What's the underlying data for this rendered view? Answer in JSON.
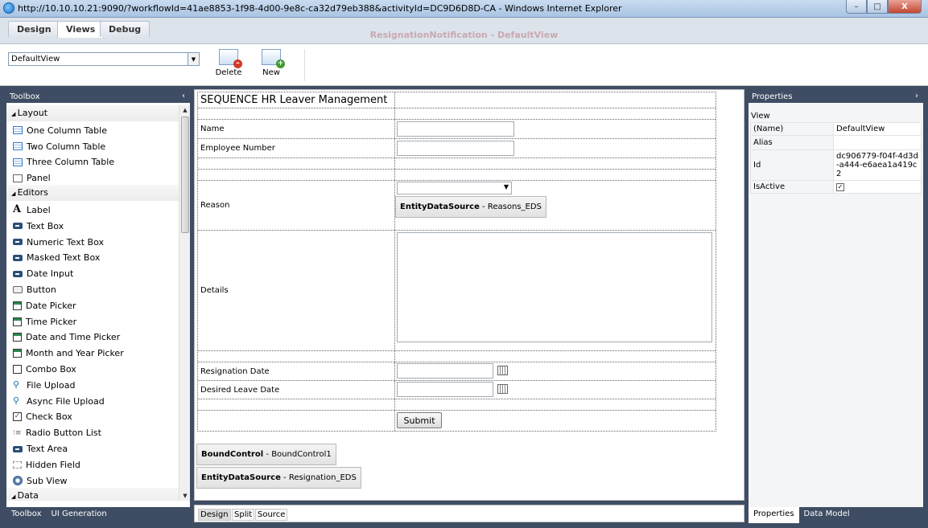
{
  "window": {
    "title": "http://10.10.10.21:9090/?workflowId=41ae8853-1f98-4d00-9e8c-ca32d79eb388&activityId=DC9D6D8D-CA - Windows Internet Explorer",
    "min": "–",
    "max": "□",
    "close": "X"
  },
  "tabs": [
    {
      "label": "Design",
      "active": false
    },
    {
      "label": "Views",
      "active": true
    },
    {
      "label": "Debug",
      "active": false
    }
  ],
  "caption": "ResignationNotification - DefaultView",
  "ribbon": {
    "view_select": "DefaultView",
    "delete_label": "Delete",
    "new_label": "New"
  },
  "toolbox": {
    "header": "Toolbox",
    "collapse": "‹",
    "groups": [
      {
        "label": "Layout",
        "items": [
          {
            "label": "One Column Table",
            "icon": "table-icon"
          },
          {
            "label": "Two Column Table",
            "icon": "table-icon"
          },
          {
            "label": "Three Column Table",
            "icon": "table-icon"
          },
          {
            "label": "Panel",
            "icon": "panel-icon"
          }
        ]
      },
      {
        "label": "Editors",
        "items": [
          {
            "label": "Label",
            "icon": "label-icon"
          },
          {
            "label": "Text Box",
            "icon": "textbox-icon"
          },
          {
            "label": "Numeric Text Box",
            "icon": "textbox-icon"
          },
          {
            "label": "Masked Text Box",
            "icon": "textbox-icon"
          },
          {
            "label": "Date Input",
            "icon": "textbox-icon"
          },
          {
            "label": "Button",
            "icon": "button-icon"
          },
          {
            "label": "Date Picker",
            "icon": "calendar-icon"
          },
          {
            "label": "Time Picker",
            "icon": "calendar-icon"
          },
          {
            "label": "Date and Time Picker",
            "icon": "calendar-icon"
          },
          {
            "label": "Month and Year Picker",
            "icon": "calendar-icon"
          },
          {
            "label": "Combo Box",
            "icon": "combo-icon"
          },
          {
            "label": "File Upload",
            "icon": "upload-icon"
          },
          {
            "label": "Async File Upload",
            "icon": "upload-icon"
          },
          {
            "label": "Check Box",
            "icon": "checkbox-icon"
          },
          {
            "label": "Radio Button List",
            "icon": "radio-list-icon"
          },
          {
            "label": "Text Area",
            "icon": "textbox-icon"
          },
          {
            "label": "Hidden Field",
            "icon": "hidden-field-icon"
          },
          {
            "label": "Sub View",
            "icon": "gear-icon"
          }
        ]
      },
      {
        "label": "Data",
        "items": []
      }
    ],
    "bottom_tabs": [
      "Toolbox",
      "UI Generation"
    ]
  },
  "form": {
    "title": "SEQUENCE HR Leaver Management",
    "name_label": "Name",
    "employee_number_label": "Employee Number",
    "reason_label": "Reason",
    "reason_eds_bold": "EntityDataSource",
    "reason_eds_text": " - Reasons_EDS",
    "details_label": "Details",
    "resignation_date_label": "Resignation Date",
    "desired_leave_date_label": "Desired Leave Date",
    "submit_label": "Submit"
  },
  "canvas": {
    "bound_bold": "BoundControl",
    "bound_text": " - BoundControl1",
    "eds_bold": "EntityDataSource",
    "eds_text": " - Resignation_EDS",
    "tabs": [
      "Design",
      "Split",
      "Source"
    ]
  },
  "properties": {
    "header": "Properties",
    "expand": "›",
    "section": "View",
    "rows": [
      {
        "key": "(Name)",
        "value": "DefaultView"
      },
      {
        "key": "Alias",
        "value": ""
      },
      {
        "key": "Id",
        "value": "dc906779-f04f-4d3d-a444-e6aea1a419c2"
      },
      {
        "key": "IsActive",
        "value": "✓"
      }
    ],
    "bottom_tabs": [
      "Properties",
      "Data Model"
    ]
  }
}
